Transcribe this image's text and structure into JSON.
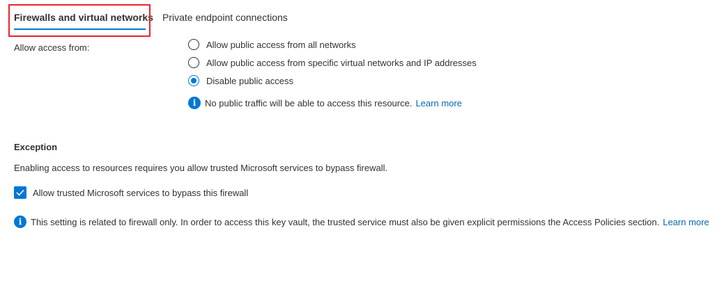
{
  "tabs": {
    "firewalls_label": "Firewalls and virtual networks",
    "private_label": "Private endpoint connections",
    "active": "firewalls"
  },
  "access": {
    "label": "Allow access from:",
    "options": [
      {
        "label": "Allow public access from all networks",
        "selected": false
      },
      {
        "label": "Allow public access from specific virtual networks and IP addresses",
        "selected": false
      },
      {
        "label": "Disable public access",
        "selected": true
      }
    ],
    "info_text": "No public traffic will be able to access this resource.",
    "info_link": "Learn more"
  },
  "exception": {
    "title": "Exception",
    "description": "Enabling access to resources requires you allow trusted Microsoft services to bypass firewall.",
    "checkbox_label": "Allow trusted Microsoft services to bypass this firewall",
    "checkbox_checked": true,
    "info_text": "This setting is related to firewall only. In order to access this key vault, the trusted service must also be given explicit permissions the Access Policies section.",
    "info_link": "Learn more"
  },
  "colors": {
    "accent": "#0078d4",
    "link": "#0067b8",
    "highlight": "#e8252a",
    "text": "#323130"
  }
}
